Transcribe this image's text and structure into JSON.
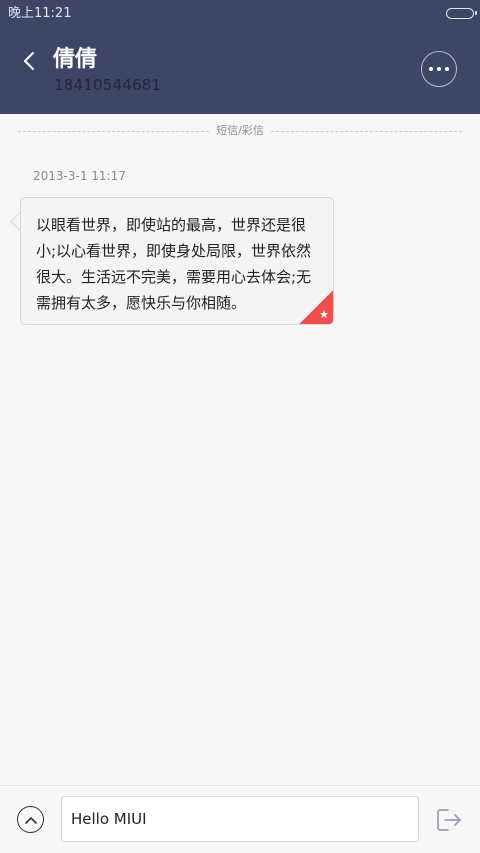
{
  "status_bar": {
    "time": "晚上11:21"
  },
  "header": {
    "contact_name": "倩倩",
    "contact_number": "18410544681"
  },
  "conversation": {
    "divider_label": "短信/彩信",
    "messages": [
      {
        "timestamp": "2013-3-1 11:17",
        "text": "以眼看世界，即使站的最高，世界还是很小;以心看世界，即使身处局限，世界依然很大。生活远不完美，需要用心去体会;无需拥有太多，愿快乐与你相随。",
        "favorited": true
      }
    ]
  },
  "composer": {
    "input_value": "Hello MIUI"
  },
  "icons": {
    "back": "chevron-left-icon",
    "more": "more-dots-icon",
    "favorite": "star-icon",
    "expand": "chevron-up-icon",
    "send": "send-icon"
  },
  "colors": {
    "header_bg": "#3e4668",
    "favorite_badge": "#f04f4f",
    "background": "#f7f7f7"
  }
}
